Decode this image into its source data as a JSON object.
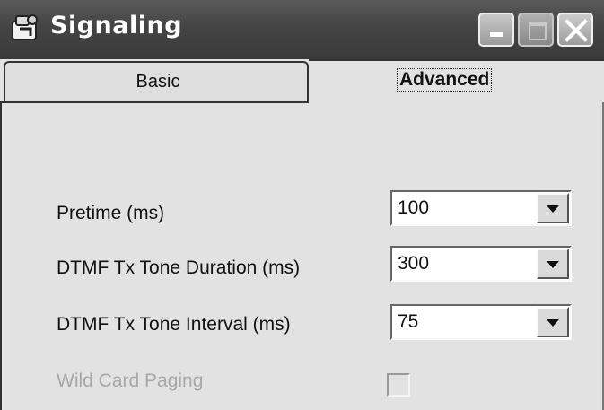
{
  "window": {
    "title": "Signaling"
  },
  "tabs": [
    {
      "label": "Basic",
      "selected": false
    },
    {
      "label": "Advanced",
      "selected": true
    }
  ],
  "fields": [
    {
      "label": "Pretime (ms)",
      "value": "100"
    },
    {
      "label": "DTMF Tx Tone Duration (ms)",
      "value": "300"
    },
    {
      "label": "DTMF Tx Tone Interval (ms)",
      "value": "75"
    }
  ],
  "wild_card_paging": {
    "label": "Wild Card Paging",
    "checked": false,
    "enabled": false
  },
  "icons": {
    "app": "signaling-app-icon",
    "minimize": "minimize-icon",
    "maximize": "maximize-icon",
    "close": "close-icon",
    "dropdown": "chevron-down-icon"
  }
}
